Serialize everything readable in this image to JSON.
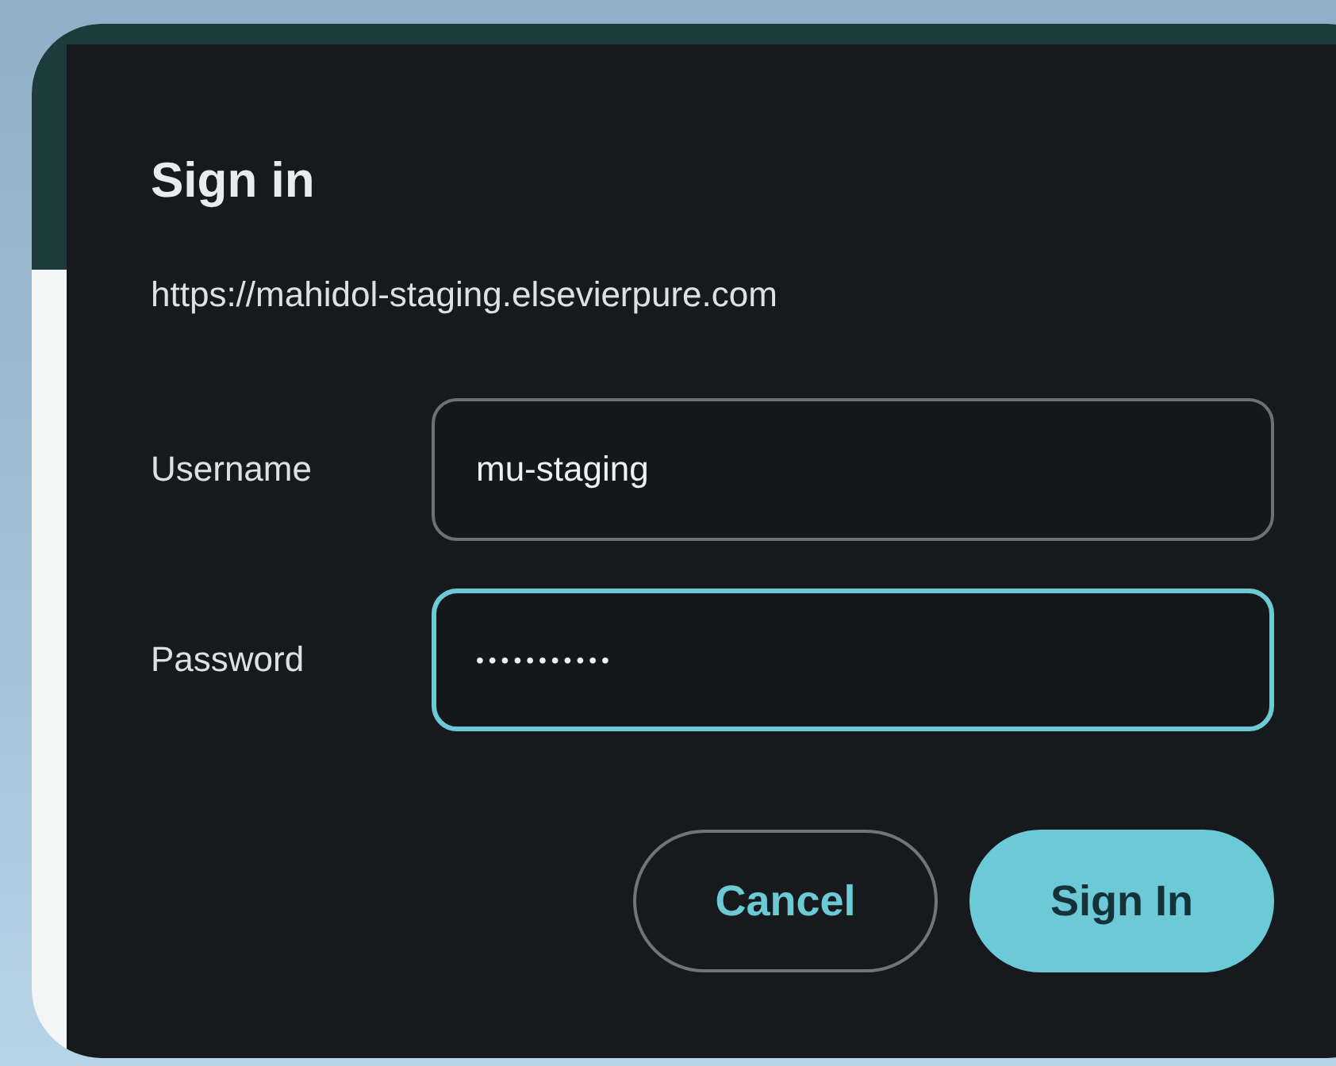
{
  "dialog": {
    "title": "Sign in",
    "origin": "https://mahidol-staging.elsevierpure.com"
  },
  "fields": [
    {
      "label": "Username",
      "value": "mu-staging",
      "focused": false
    },
    {
      "label": "Password",
      "value": "•••••••••••",
      "focused": true
    }
  ],
  "buttons": [
    {
      "label": "Cancel",
      "kind": "secondary"
    },
    {
      "label": "Sign In",
      "kind": "primary"
    }
  ]
}
